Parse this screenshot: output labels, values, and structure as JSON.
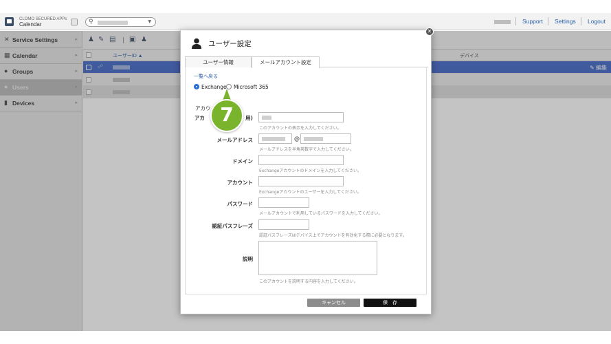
{
  "app": {
    "name": "CLOMO SECURED APPs",
    "sub": "Calendar"
  },
  "header_links": {
    "support": "Support",
    "settings": "Settings",
    "logout": "Logout"
  },
  "sidebar": {
    "items": [
      {
        "label": "Service Settings"
      },
      {
        "label": "Calendar"
      },
      {
        "label": "Groups"
      },
      {
        "label": "Users"
      },
      {
        "label": "Devices"
      }
    ]
  },
  "grid": {
    "col_userid": "ユーザーID ▲",
    "col_device": "デバイス",
    "edit_label": "編集"
  },
  "modal": {
    "title": "ユーザー設定",
    "tabs": [
      "ユーザー情報",
      "メールアカウント設定"
    ],
    "back_link": "一覧へ戻る",
    "radio_exchange": "Exchange",
    "radio_m365": "Microsoft 365",
    "section_head": "アカウ",
    "fields": {
      "account_name_label_a": "アカ",
      "account_name_label_b": "用)",
      "account_name_help": "このアカウントの表示を入力してください。",
      "email_label": "メールアドレス",
      "email_at": "@",
      "email_help": "メールアドレスを半角英数字で入力してください。",
      "domain_label": "ドメイン",
      "domain_help": "Exchangeアカウントのドメインを入力してください。",
      "account_label": "アカウント",
      "account_help": "Exchangeアカウントのユーザーを入力してください。",
      "password_label": "パスワード",
      "password_help": "メールアカウントで利用しているパスワードを入力してください。",
      "passphrase_label": "認証パスフレーズ",
      "passphrase_help": "認証パスフレーズはデバイス上でアカウントを有効化する際に必要となります。",
      "description_label": "説明",
      "description_help": "このアカウントを説明する内容を入力してください。"
    },
    "cancel_label": "キャンセル",
    "save_label": "保　存"
  },
  "step_badge": "7",
  "colors": {
    "accent": "#2b6fd6",
    "selected_row": "#3d63c7",
    "badge": "#7ab42d"
  }
}
